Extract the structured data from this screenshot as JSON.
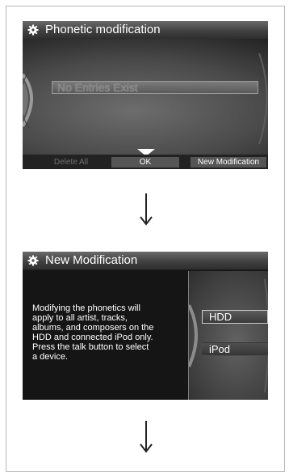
{
  "screen1": {
    "title": "Phonetic modification",
    "list_entry": "No Entries Exist",
    "bottom": {
      "delete_all": "Delete All",
      "ok": "OK",
      "new_modification": "New Modification"
    }
  },
  "screen2": {
    "title": "New Modification",
    "message": "Modifying the phonetics will\napply to all artist, tracks,\nalbums, and composers on the\nHDD and connected iPod only.\nPress the talk button to select\na device.",
    "options": [
      "HDD",
      "iPod"
    ]
  },
  "icons": [
    "gear-icon",
    "cursor-triangle-icon",
    "down-arrow-icon",
    "down-arrow-icon"
  ]
}
